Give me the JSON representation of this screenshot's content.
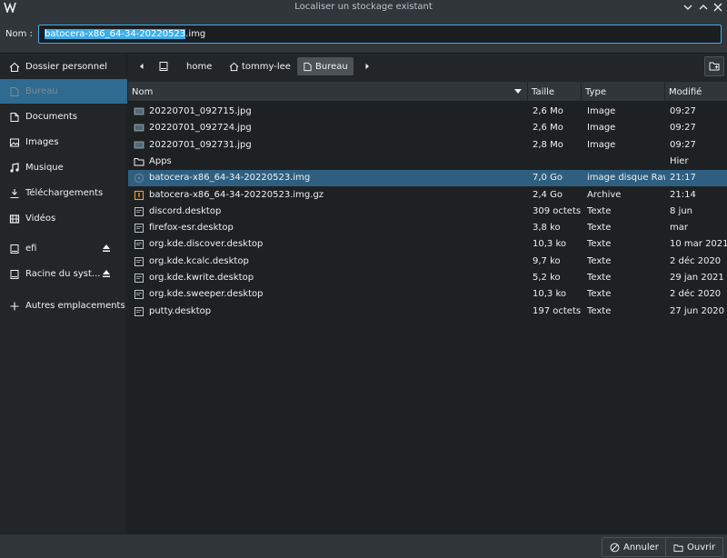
{
  "window": {
    "title": "Localiser un stockage existant"
  },
  "name_field": {
    "label": "Nom :",
    "selected_part": "batocera-x86_64-34-20220523",
    "rest": ".img"
  },
  "sidebar": {
    "items": [
      {
        "label": "Dossier personnel",
        "icon": "home-icon"
      },
      {
        "label": "Bureau",
        "icon": "desktop-icon"
      },
      {
        "label": "Documents",
        "icon": "documents-icon"
      },
      {
        "label": "Images",
        "icon": "images-icon"
      },
      {
        "label": "Musique",
        "icon": "music-icon"
      },
      {
        "label": "Téléchargements",
        "icon": "download-icon"
      },
      {
        "label": "Vidéos",
        "icon": "video-icon"
      },
      {
        "label": "efi",
        "icon": "drive-icon"
      },
      {
        "label": "Racine du syst...",
        "icon": "drive-icon"
      },
      {
        "label": "Autres emplacements",
        "icon": "plus-icon"
      }
    ]
  },
  "breadcrumb": {
    "items": [
      "home",
      "tommy-lee",
      "Bureau"
    ]
  },
  "table": {
    "columns": [
      "Nom",
      "Taille",
      "Type",
      "Modifié"
    ],
    "rows": [
      {
        "name": "20220701_092715.jpg",
        "size": "2,6 Mo",
        "type": "Image",
        "modified": "09:27",
        "icon": "image-file-icon"
      },
      {
        "name": "20220701_092724.jpg",
        "size": "2,6 Mo",
        "type": "Image",
        "modified": "09:27",
        "icon": "image-file-icon"
      },
      {
        "name": "20220701_092731.jpg",
        "size": "2,8 Mo",
        "type": "Image",
        "modified": "09:27",
        "icon": "image-file-icon"
      },
      {
        "name": "Apps",
        "size": "",
        "type": "",
        "modified": "Hier",
        "icon": "folder-icon"
      },
      {
        "name": "batocera-x86_64-34-20220523.img",
        "size": "7,0 Go",
        "type": "image disque Raw",
        "modified": "21:17",
        "icon": "disk-image-icon"
      },
      {
        "name": "batocera-x86_64-34-20220523.img.gz",
        "size": "2,4 Go",
        "type": "Archive",
        "modified": "21:14",
        "icon": "archive-icon"
      },
      {
        "name": "discord.desktop",
        "size": "309 octets",
        "type": "Texte",
        "modified": "8 jun",
        "icon": "text-file-icon"
      },
      {
        "name": "firefox-esr.desktop",
        "size": "3,8 ko",
        "type": "Texte",
        "modified": "mar",
        "icon": "text-file-icon"
      },
      {
        "name": "org.kde.discover.desktop",
        "size": "10,3 ko",
        "type": "Texte",
        "modified": "10 mar 2021",
        "icon": "text-file-icon"
      },
      {
        "name": "org.kde.kcalc.desktop",
        "size": "9,7 ko",
        "type": "Texte",
        "modified": "2 déc 2020",
        "icon": "text-file-icon"
      },
      {
        "name": "org.kde.kwrite.desktop",
        "size": "5,2 ko",
        "type": "Texte",
        "modified": "29 jan 2021",
        "icon": "text-file-icon"
      },
      {
        "name": "org.kde.sweeper.desktop",
        "size": "10,3 ko",
        "type": "Texte",
        "modified": "2 déc 2020",
        "icon": "text-file-icon"
      },
      {
        "name": "putty.desktop",
        "size": "197 octets",
        "type": "Texte",
        "modified": "27 jun 2020",
        "icon": "text-file-icon"
      }
    ]
  },
  "footer": {
    "cancel_label": "Annuler",
    "open_label": "Ouvrir"
  },
  "colors": {
    "accent": "#3daee9",
    "selection": "#2f5f80",
    "background": "#232629"
  }
}
